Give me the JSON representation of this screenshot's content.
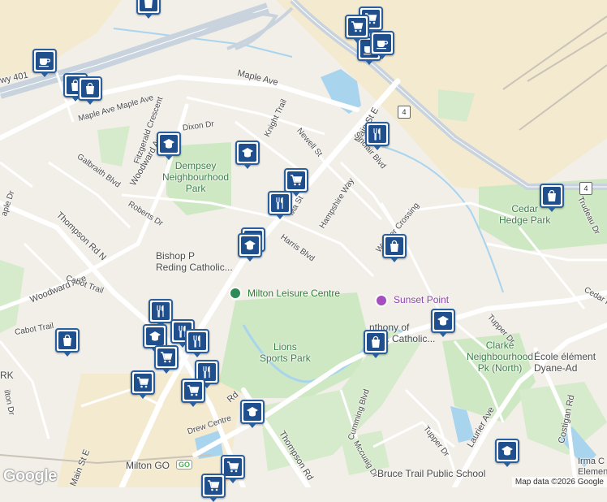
{
  "map": {
    "attribution": "Map data ©2026 Google",
    "logo": "Google",
    "colors": {
      "park": "#cfe8c4",
      "water": "#a8d4ee",
      "road": "#ffffff",
      "highway": "#c9d3de",
      "land": "#f2efe9",
      "pin": "#1f4f8c"
    }
  },
  "roads": [
    {
      "id": "maple-ave-1",
      "text": "Maple Ave"
    },
    {
      "id": "maple-ave-2",
      "text": "Maple Ave Maple Ave"
    },
    {
      "id": "hwy-401",
      "text": "wy 401"
    },
    {
      "id": "main-st-e",
      "text": "Main St E"
    },
    {
      "id": "sinclair-blvd",
      "text": "Sinclair Blvd"
    },
    {
      "id": "hampshire-way",
      "text": "Hampshire Way"
    },
    {
      "id": "harris-blvd",
      "text": "Harris Blvd"
    },
    {
      "id": "woodward-ave-1",
      "text": "Woodward Ave"
    },
    {
      "id": "woodward-ave-2",
      "text": "Woodward Ave"
    },
    {
      "id": "fitzgerald",
      "text": "Fitzgerald Crescent"
    },
    {
      "id": "dixon-dr",
      "text": "Dixon Dr"
    },
    {
      "id": "knight-trail",
      "text": "Knight Trail"
    },
    {
      "id": "newell-st",
      "text": "Newell St"
    },
    {
      "id": "galbraith",
      "text": "Galbraith Blvd"
    },
    {
      "id": "roberts-dr",
      "text": "Roberts Dr"
    },
    {
      "id": "thompson-rd-n",
      "text": "Thompson Rd N"
    },
    {
      "id": "cabot-trail-1",
      "text": "Cabot Trail"
    },
    {
      "id": "cabot-trail-2",
      "text": "Cabot Trail"
    },
    {
      "id": "weaver-crossing",
      "text": "Weaver Crossing"
    },
    {
      "id": "tupper-dr-1",
      "text": "Tupper Dr"
    },
    {
      "id": "tupper-dr-2",
      "text": "Tupper Dr"
    },
    {
      "id": "cumming-blvd",
      "text": "Cumming Blvd"
    },
    {
      "id": "mccuaig-dr",
      "text": "Mccuaig Dr"
    },
    {
      "id": "laurier-ave",
      "text": "Laurier Ave"
    },
    {
      "id": "costigan-rd",
      "text": "Costigan Rd"
    },
    {
      "id": "trudeau-dr",
      "text": "Trudeau Dr"
    },
    {
      "id": "drew-centre",
      "text": "Drew Centre"
    },
    {
      "id": "thompson-rd-s",
      "text": "Thompson Rd"
    },
    {
      "id": "main-st-e-2",
      "text": "Main St E"
    },
    {
      "id": "ma-st",
      "text": "Ma St"
    },
    {
      "id": "maple-dr",
      "text": "aple Dr"
    },
    {
      "id": "milton-dr",
      "text": "ilton Dr"
    },
    {
      "id": "rd-stub",
      "text": "Rd"
    },
    {
      "id": "cedar-stub",
      "text": "Cedar H"
    },
    {
      "id": "hwy-4a",
      "text": "4"
    },
    {
      "id": "hwy-4b",
      "text": "4"
    }
  ],
  "places": [
    {
      "id": "dempsey-park",
      "text": "Dempsey\nNeighbourhood\nPark"
    },
    {
      "id": "lions-park",
      "text": "Lions\nSports Park"
    },
    {
      "id": "cedar-hedge",
      "text": "Cedar\nHedge Park"
    },
    {
      "id": "clarke-park",
      "text": "Clarke\nNeighbourhood\nPk (North)"
    },
    {
      "id": "bishop-reding",
      "text": "Bishop P\nReding Catholic..."
    },
    {
      "id": "anthony-catholic",
      "text": "nthony of\nPa... Catholic..."
    },
    {
      "id": "ecole",
      "text": "École élément\nDyane-Ad"
    },
    {
      "id": "bruce-trail",
      "text": "Bruce Trail Public School"
    },
    {
      "id": "irma",
      "text": "Irma C\nElemen"
    },
    {
      "id": "milton-go",
      "text": "Milton GO"
    },
    {
      "id": "park-k",
      "text": "RK"
    }
  ],
  "poi": [
    {
      "id": "milton-leisure",
      "text": "Milton Leisure Centre"
    },
    {
      "id": "sunset-point",
      "text": "Sunset Point"
    }
  ]
}
